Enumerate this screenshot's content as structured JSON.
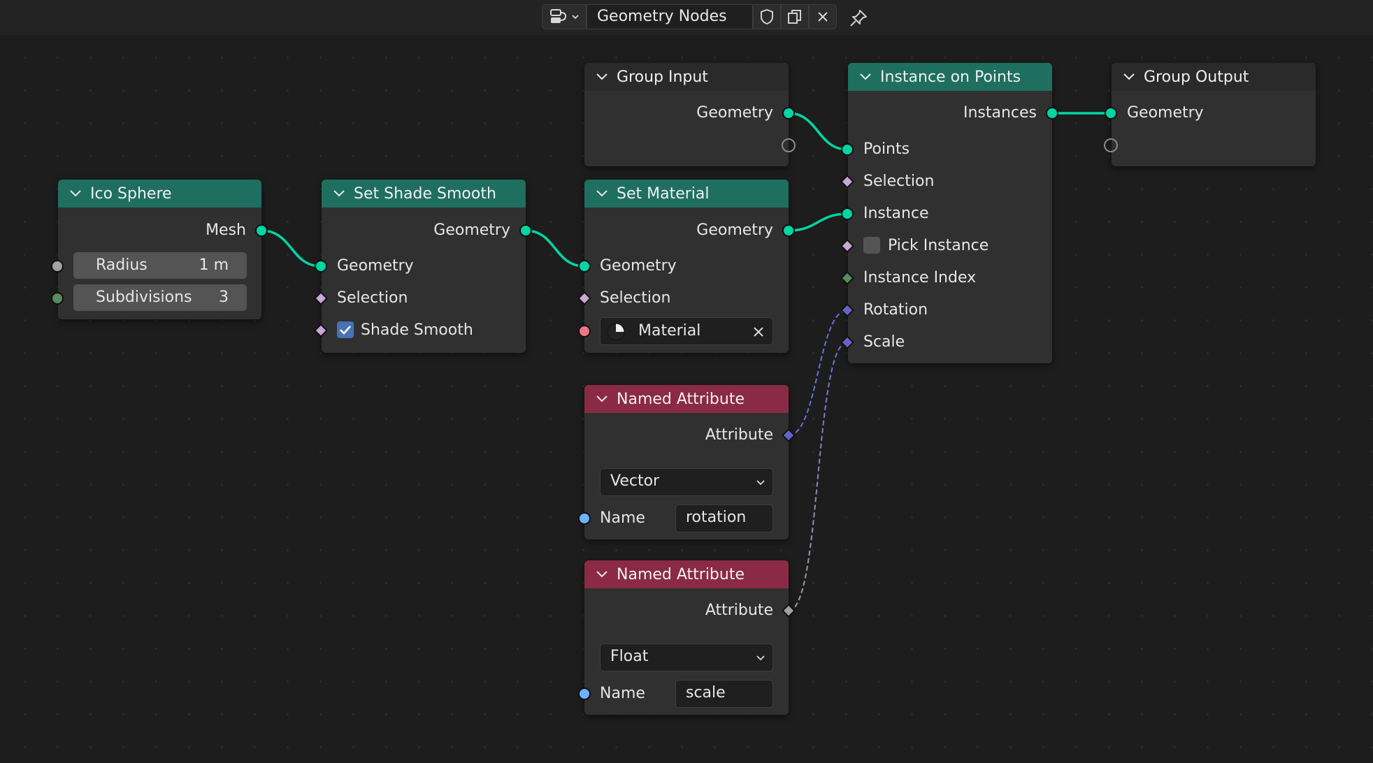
{
  "header": {
    "tree_name": "Geometry Nodes",
    "editor_icon": "node-editor-icon",
    "buttons": [
      "fake-user-shield-icon",
      "duplicate-icon",
      "close-icon",
      "pin-icon"
    ]
  },
  "nodes": {
    "ico_sphere": {
      "title": "Ico Sphere",
      "output": "Mesh",
      "radius_label": "Radius",
      "radius_value": "1 m",
      "subdivisions_label": "Subdivisions",
      "subdivisions_value": "3"
    },
    "set_shade_smooth": {
      "title": "Set Shade Smooth",
      "output": "Geometry",
      "input_geometry": "Geometry",
      "input_selection": "Selection",
      "input_shade_smooth": "Shade Smooth",
      "shade_smooth_checked": true
    },
    "group_input": {
      "title": "Group Input",
      "output": "Geometry"
    },
    "set_material": {
      "title": "Set Material",
      "output": "Geometry",
      "input_geometry": "Geometry",
      "input_selection": "Selection",
      "material_label": "Material"
    },
    "instance_on_points": {
      "title": "Instance on Points",
      "output": "Instances",
      "inputs": [
        "Points",
        "Selection",
        "Instance",
        "Pick Instance",
        "Instance Index",
        "Rotation",
        "Scale"
      ],
      "pick_instance_checked": false
    },
    "group_output": {
      "title": "Group Output",
      "input": "Geometry"
    },
    "named_attr_1": {
      "title": "Named Attribute",
      "output": "Attribute",
      "type": "Vector",
      "name_label": "Name",
      "name_value": "rotation"
    },
    "named_attr_2": {
      "title": "Named Attribute",
      "output": "Attribute",
      "type": "Float",
      "name_label": "Name",
      "name_value": "scale"
    }
  },
  "colors": {
    "geometry_socket": "#00d6a3",
    "field_socket": "#cca6d6",
    "int_socket": "#598c5c",
    "vector_socket": "#6363c7",
    "float_socket": "#a1a1a1",
    "string_socket": "#70b2ff",
    "material_socket": "#eb7582",
    "header_green": "#1f6f60",
    "header_red": "#8a2a46"
  }
}
